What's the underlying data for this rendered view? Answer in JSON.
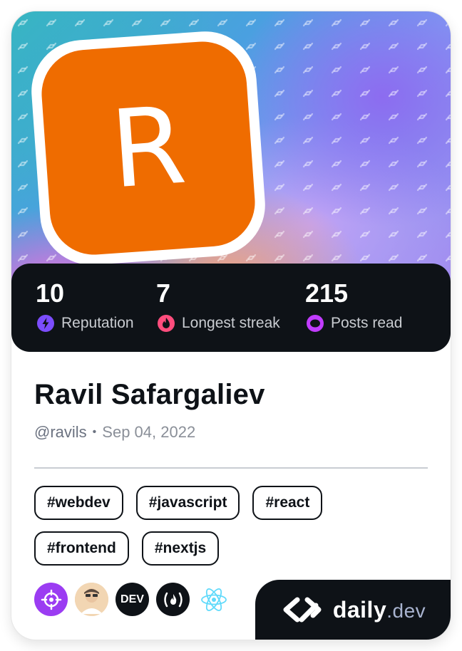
{
  "profile": {
    "avatar_initial": "R",
    "avatar_color": "#ef6c00",
    "name": "Ravil Safargaliev",
    "handle": "@ravils",
    "separator": "•",
    "joined": "Sep 04, 2022"
  },
  "stats": [
    {
      "value": "10",
      "label": "Reputation",
      "icon": "lightning-icon",
      "color": "#7c4dff"
    },
    {
      "value": "7",
      "label": "Longest streak",
      "icon": "flame-icon",
      "color": "#ff4d7d"
    },
    {
      "value": "215",
      "label": "Posts read",
      "icon": "eye-icon",
      "color": "#c13cff"
    }
  ],
  "tags": {
    "row1": [
      "#webdev",
      "#javascript",
      "#react"
    ],
    "row2": [
      "#frontend",
      "#nextjs"
    ]
  },
  "squads": [
    {
      "name": "crosshair-squad-icon",
      "color": "#9b3cf2"
    },
    {
      "name": "person-avatar-squad-icon",
      "color": "#f0b46a"
    },
    {
      "name": "dev-squad-icon",
      "label": "DEV",
      "color": "#0e1217"
    },
    {
      "name": "freecodecamp-squad-icon",
      "label": "(🔥)",
      "color": "#0e1217"
    },
    {
      "name": "react-squad-icon",
      "color": "#61dafb"
    }
  ],
  "brand": {
    "name": "daily",
    "suffix": ".dev"
  }
}
